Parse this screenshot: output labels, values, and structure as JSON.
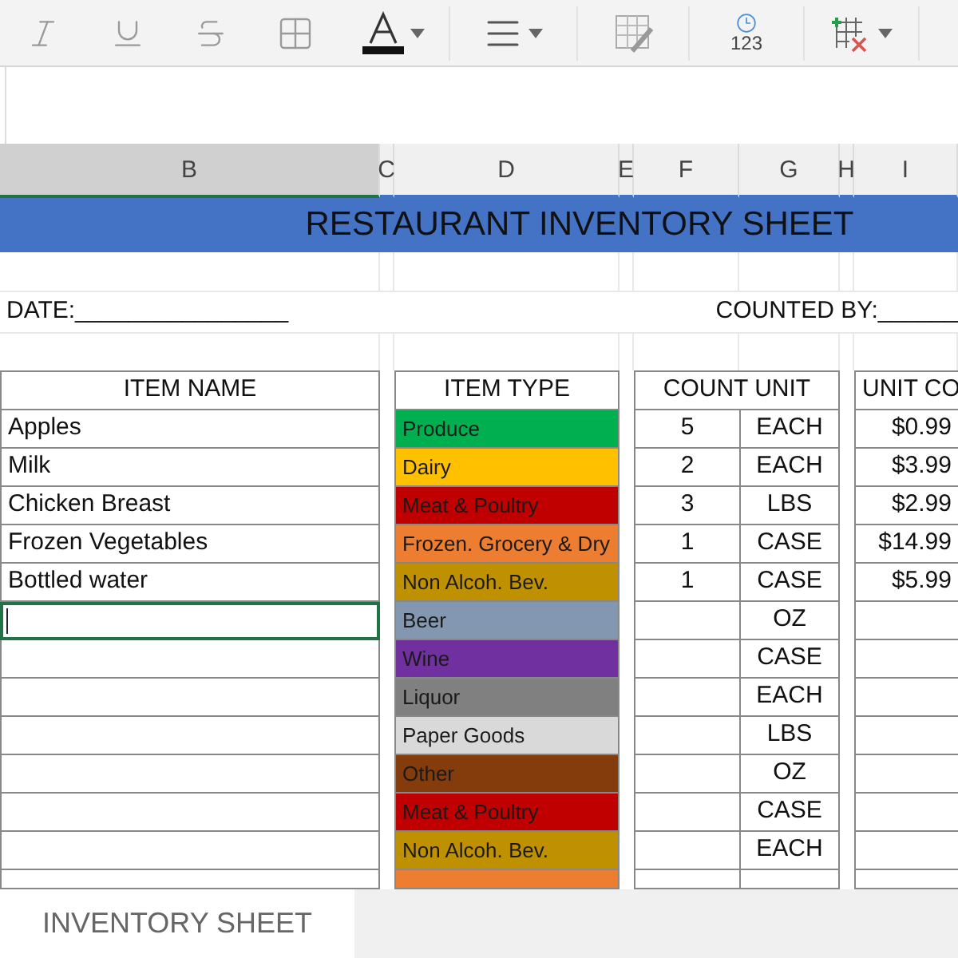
{
  "toolbar": [
    {
      "kind": "italic"
    },
    {
      "kind": "underline"
    },
    {
      "kind": "strike"
    },
    {
      "kind": "borders"
    },
    {
      "kind": "fontcolor"
    },
    {
      "kind": "align"
    },
    {
      "kind": "format"
    },
    {
      "kind": "numformat",
      "label": "123"
    },
    {
      "kind": "cells"
    }
  ],
  "columns": [
    {
      "label": "B",
      "selected": true
    },
    {
      "label": "C",
      "selected": false
    },
    {
      "label": "D",
      "selected": false
    },
    {
      "label": "E",
      "selected": false
    },
    {
      "label": "F",
      "selected": false
    },
    {
      "label": "G",
      "selected": false
    },
    {
      "label": "H",
      "selected": false
    },
    {
      "label": "I",
      "selected": false
    }
  ],
  "title": "RESTAURANT INVENTORY SHEET",
  "date_label": "DATE:________________",
  "counted_by_label": "COUNTED BY:______",
  "headers": {
    "item_name": "ITEM NAME",
    "item_type": "ITEM TYPE",
    "count_unit": "COUNT UNIT",
    "unit_cost": "UNIT CO"
  },
  "rows": [
    {
      "name": "Apples",
      "type": "Produce",
      "color": "#00b050",
      "count": "5",
      "unit": "EACH",
      "cost": "$0.99",
      "selected": false
    },
    {
      "name": "Milk",
      "type": "Dairy",
      "color": "#ffc000",
      "count": "2",
      "unit": "EACH",
      "cost": "$3.99",
      "selected": false
    },
    {
      "name": "Chicken Breast",
      "type": "Meat & Poultry",
      "color": "#c00000",
      "count": "3",
      "unit": "LBS",
      "cost": "$2.99",
      "selected": false
    },
    {
      "name": "Frozen Vegetables",
      "type": "Frozen. Grocery & Dry",
      "color": "#ed7d31",
      "count": "1",
      "unit": "CASE",
      "cost": "$14.99",
      "selected": false
    },
    {
      "name": "Bottled water",
      "type": "Non Alcoh. Bev.",
      "color": "#bf9000",
      "count": "1",
      "unit": "CASE",
      "cost": "$5.99",
      "selected": false
    },
    {
      "type": "Beer",
      "color": "#8497b0",
      "unit": "OZ",
      "selected": true
    },
    {
      "type": "Wine",
      "color": "#7030a0",
      "unit": "CASE",
      "selected": false
    },
    {
      "type": "Liquor",
      "color": "#808080",
      "unit": "EACH",
      "selected": false
    },
    {
      "type": "Paper Goods",
      "color": "#d9d9d9",
      "unit": "LBS",
      "selected": false
    },
    {
      "type": "Other",
      "color": "#843c0c",
      "unit": "OZ",
      "selected": false
    },
    {
      "type": "Meat & Poultry",
      "color": "#c00000",
      "unit": "CASE",
      "selected": false
    },
    {
      "type": "Non Alcoh. Bev.",
      "color": "#bf9000",
      "unit": "EACH",
      "selected": false
    },
    {
      "color": "#ed7d31",
      "selected": false
    }
  ],
  "sheet_tab": {
    "label": "INVENTORY SHEET",
    "selected": true
  }
}
